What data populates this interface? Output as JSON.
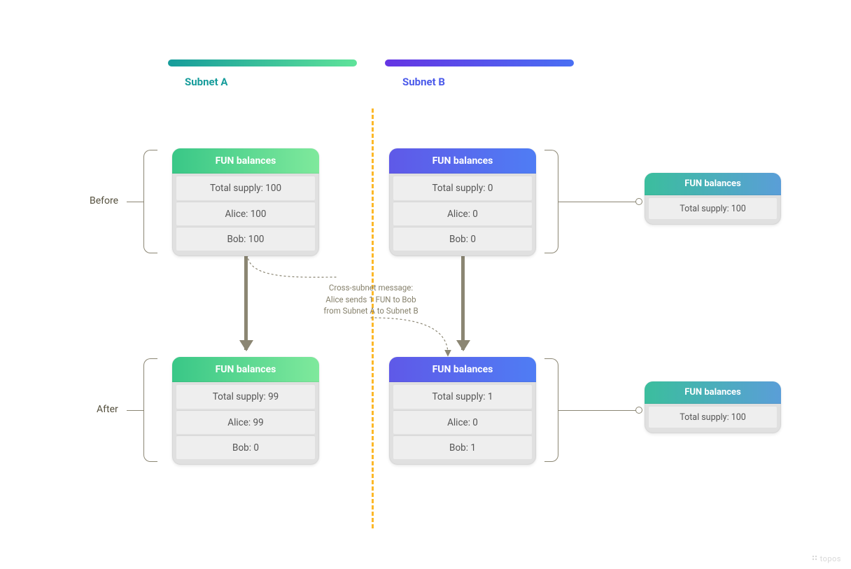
{
  "headers": {
    "subnetA": "Subnet A",
    "subnetB": "Subnet B"
  },
  "labels": {
    "before": "Before",
    "after": "After",
    "card_title": "FUN balances"
  },
  "message": {
    "line1": "Cross-subnet message:",
    "line2": "Alice sends 1 FUN to Bob",
    "line3": "from Subnet A to Subnet B"
  },
  "before": {
    "subnetA": {
      "total_supply": "Total supply: 100",
      "alice": "Alice: 100",
      "bob": "Bob: 100"
    },
    "subnetB": {
      "total_supply": "Total supply: 0",
      "alice": "Alice: 0",
      "bob": "Bob: 0"
    },
    "summary": {
      "total_supply": "Total supply: 100"
    }
  },
  "after": {
    "subnetA": {
      "total_supply": "Total supply: 99",
      "alice": "Alice: 99",
      "bob": "Bob: 0"
    },
    "subnetB": {
      "total_supply": "Total supply: 1",
      "alice": "Alice: 0",
      "bob": "Bob: 1"
    },
    "summary": {
      "total_supply": "Total supply: 100"
    }
  },
  "watermark": "topos"
}
